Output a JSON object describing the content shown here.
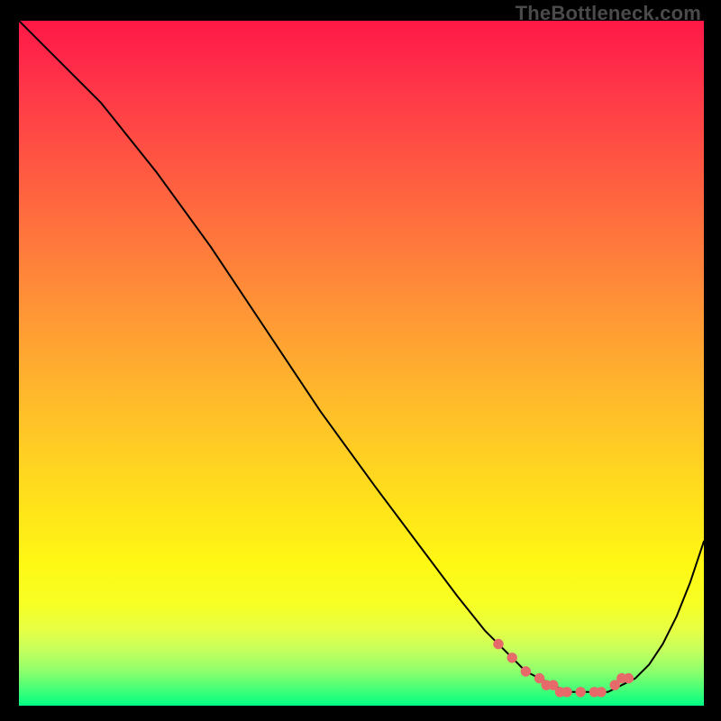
{
  "watermark": "TheBottleneck.com",
  "colors": {
    "frame_bg": "#000000",
    "watermark": "#4a4a4a",
    "curve": "#000000",
    "marker": "#e66a6a"
  },
  "chart_data": {
    "type": "line",
    "title": "",
    "xlabel": "",
    "ylabel": "",
    "xlim": [
      0,
      100
    ],
    "ylim": [
      0,
      100
    ],
    "grid": false,
    "legend": null,
    "series": [
      {
        "name": "bottleneck-curve",
        "x": [
          0,
          4,
          8,
          12,
          16,
          20,
          28,
          36,
          44,
          52,
          58,
          64,
          68,
          72,
          74,
          76,
          78,
          80,
          82,
          84,
          86,
          88,
          90,
          92,
          94,
          96,
          98,
          100
        ],
        "y": [
          100,
          96,
          92,
          88,
          83,
          78,
          67,
          55,
          43,
          32,
          24,
          16,
          11,
          7,
          5,
          4,
          3,
          2,
          2,
          2,
          2,
          3,
          4,
          6,
          9,
          13,
          18,
          24
        ]
      }
    ],
    "markers": {
      "name": "highlighted-points",
      "x": [
        70,
        72,
        74,
        76,
        77,
        78,
        79,
        80,
        82,
        84,
        85,
        87,
        88,
        89
      ],
      "y": [
        9,
        7,
        5,
        4,
        3,
        3,
        2,
        2,
        2,
        2,
        2,
        3,
        4,
        4
      ]
    },
    "background_gradient_stops": [
      {
        "pos": 0,
        "color": "#ff1846"
      },
      {
        "pos": 50,
        "color": "#ffb12e"
      },
      {
        "pos": 80,
        "color": "#fff714"
      },
      {
        "pos": 100,
        "color": "#00ff84"
      }
    ]
  }
}
